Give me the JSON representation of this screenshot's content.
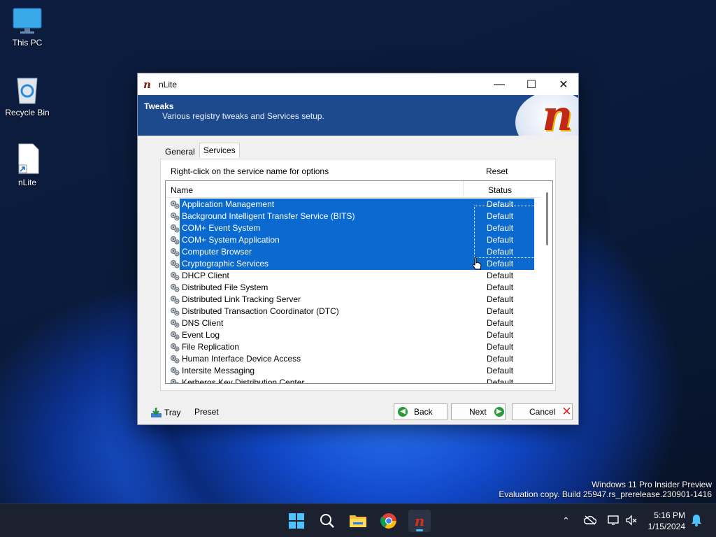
{
  "desktop": {
    "icons": [
      {
        "label": "This PC",
        "icon": "monitor-icon"
      },
      {
        "label": "Recycle Bin",
        "icon": "recycle-bin-icon"
      },
      {
        "label": "nLite",
        "icon": "shortcut-file-icon"
      }
    ],
    "watermark_line1": "Windows 11 Pro Insider Preview",
    "watermark_line2": "Evaluation copy. Build 25947.rs_prerelease.230901-1416"
  },
  "window": {
    "title": "nLite",
    "header_title": "Tweaks",
    "header_subtitle": "Various registry tweaks and Services setup.",
    "tabs": [
      {
        "label": "General",
        "active": false
      },
      {
        "label": "Services",
        "active": true
      }
    ],
    "hint": "Right-click on the service name for options",
    "reset_label": "Reset",
    "columns": {
      "name": "Name",
      "status": "Status"
    },
    "services": [
      {
        "name": "Application Management",
        "status": "Default",
        "selected": true
      },
      {
        "name": "Background Intelligent Transfer Service (BITS)",
        "status": "Default",
        "selected": true
      },
      {
        "name": "COM+ Event System",
        "status": "Default",
        "selected": true
      },
      {
        "name": "COM+ System Application",
        "status": "Default",
        "selected": true
      },
      {
        "name": "Computer Browser",
        "status": "Default",
        "selected": true
      },
      {
        "name": "Cryptographic Services",
        "status": "Default",
        "selected": true
      },
      {
        "name": "DHCP Client",
        "status": "Default",
        "selected": false
      },
      {
        "name": "Distributed File System",
        "status": "Default",
        "selected": false
      },
      {
        "name": "Distributed Link Tracking Server",
        "status": "Default",
        "selected": false
      },
      {
        "name": "Distributed Transaction Coordinator (DTC)",
        "status": "Default",
        "selected": false
      },
      {
        "name": "DNS Client",
        "status": "Default",
        "selected": false
      },
      {
        "name": "Event Log",
        "status": "Default",
        "selected": false
      },
      {
        "name": "File Replication",
        "status": "Default",
        "selected": false
      },
      {
        "name": "Human Interface Device Access",
        "status": "Default",
        "selected": false
      },
      {
        "name": "Intersite Messaging",
        "status": "Default",
        "selected": false
      },
      {
        "name": "Kerberos Key Distribution Center",
        "status": "Default",
        "selected": false
      }
    ],
    "footer": {
      "tray": "Tray",
      "preset": "Preset",
      "back": "Back",
      "next": "Next",
      "cancel": "Cancel"
    }
  },
  "taskbar": {
    "apps": [
      "start-icon",
      "search-icon",
      "file-explorer-icon",
      "chrome-icon",
      "nlite-icon"
    ],
    "time": "5:16 PM",
    "date": "1/15/2024"
  },
  "colors": {
    "selection": "#0a6ad0",
    "header": "#1c4a8c",
    "taskbar": "#1c2130"
  }
}
